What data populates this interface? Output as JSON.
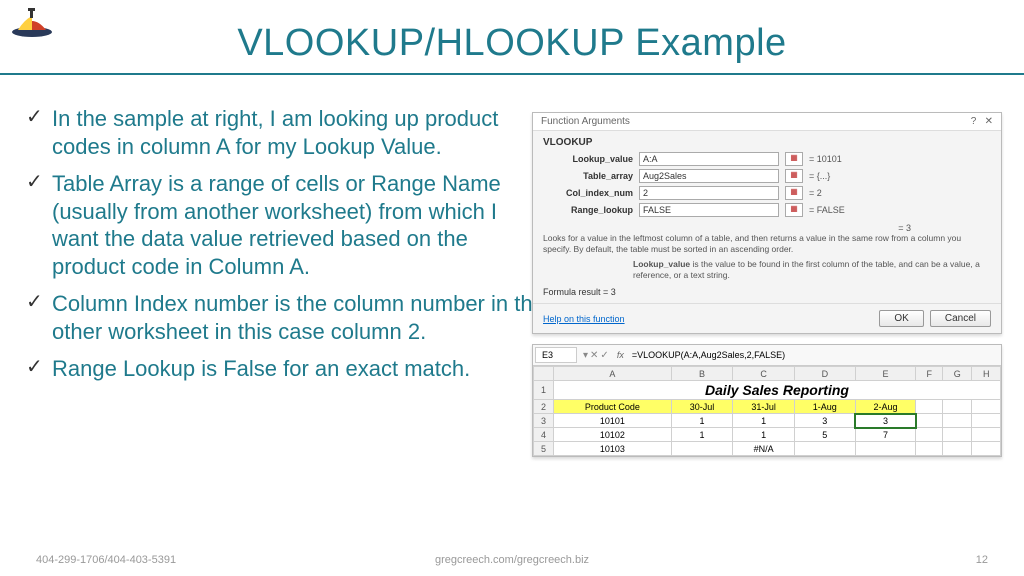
{
  "title": "VLOOKUP/HLOOKUP Example",
  "bullets": {
    "b1": "In the sample at right, I am looking up product codes in column A for my Lookup Value.",
    "b2": "Table Array is a range of cells or Range Name (usually from another worksheet) from which I want the data value retrieved based on the product code in Column A.",
    "b3": "Column Index number is the column number in the table that I want to transfer the value to my other worksheet in this case column 2.",
    "b4": "Range Lookup is False for an exact match."
  },
  "dialog": {
    "wintitle": "Function Arguments",
    "name": "VLOOKUP",
    "params": {
      "lookup_value": {
        "label": "Lookup_value",
        "value": "A:A",
        "result": "= 10101"
      },
      "table_array": {
        "label": "Table_array",
        "value": "Aug2Sales",
        "result": "= {...}"
      },
      "col_index": {
        "label": "Col_index_num",
        "value": "2",
        "result": "= 2"
      },
      "range_lookup": {
        "label": "Range_lookup",
        "value": "FALSE",
        "result": "= FALSE"
      }
    },
    "eq_result": "= 3",
    "desc1": "Looks for a value in the leftmost column of a table, and then returns a value in the same row from a column you specify. By default, the table must be sorted in an ascending order.",
    "desc2_label": "Lookup_value",
    "desc2_text": " is the value to be found in the first column of the table, and can be a value, a reference, or a text string.",
    "formula_result": "Formula result =  3",
    "help": "Help on this function",
    "ok": "OK",
    "cancel": "Cancel"
  },
  "excel": {
    "cellref": "E3",
    "formula": "=VLOOKUP(A:A,Aug2Sales,2,FALSE)",
    "cols": [
      "",
      "A",
      "B",
      "C",
      "D",
      "E",
      "F",
      "G",
      "H"
    ],
    "title_row": "Daily Sales Reporting",
    "headers": [
      "Product Code",
      "30-Jul",
      "31-Jul",
      "1-Aug",
      "2-Aug"
    ],
    "rows": [
      [
        "10101",
        "1",
        "1",
        "3",
        "3"
      ],
      [
        "10102",
        "1",
        "1",
        "5",
        "7"
      ],
      [
        "10103",
        "",
        "#N/A",
        "",
        ""
      ]
    ]
  },
  "footer": {
    "left": "404-299-1706/404-403-5391",
    "center": "gregcreech.com/gregcreech.biz",
    "right": "12"
  }
}
